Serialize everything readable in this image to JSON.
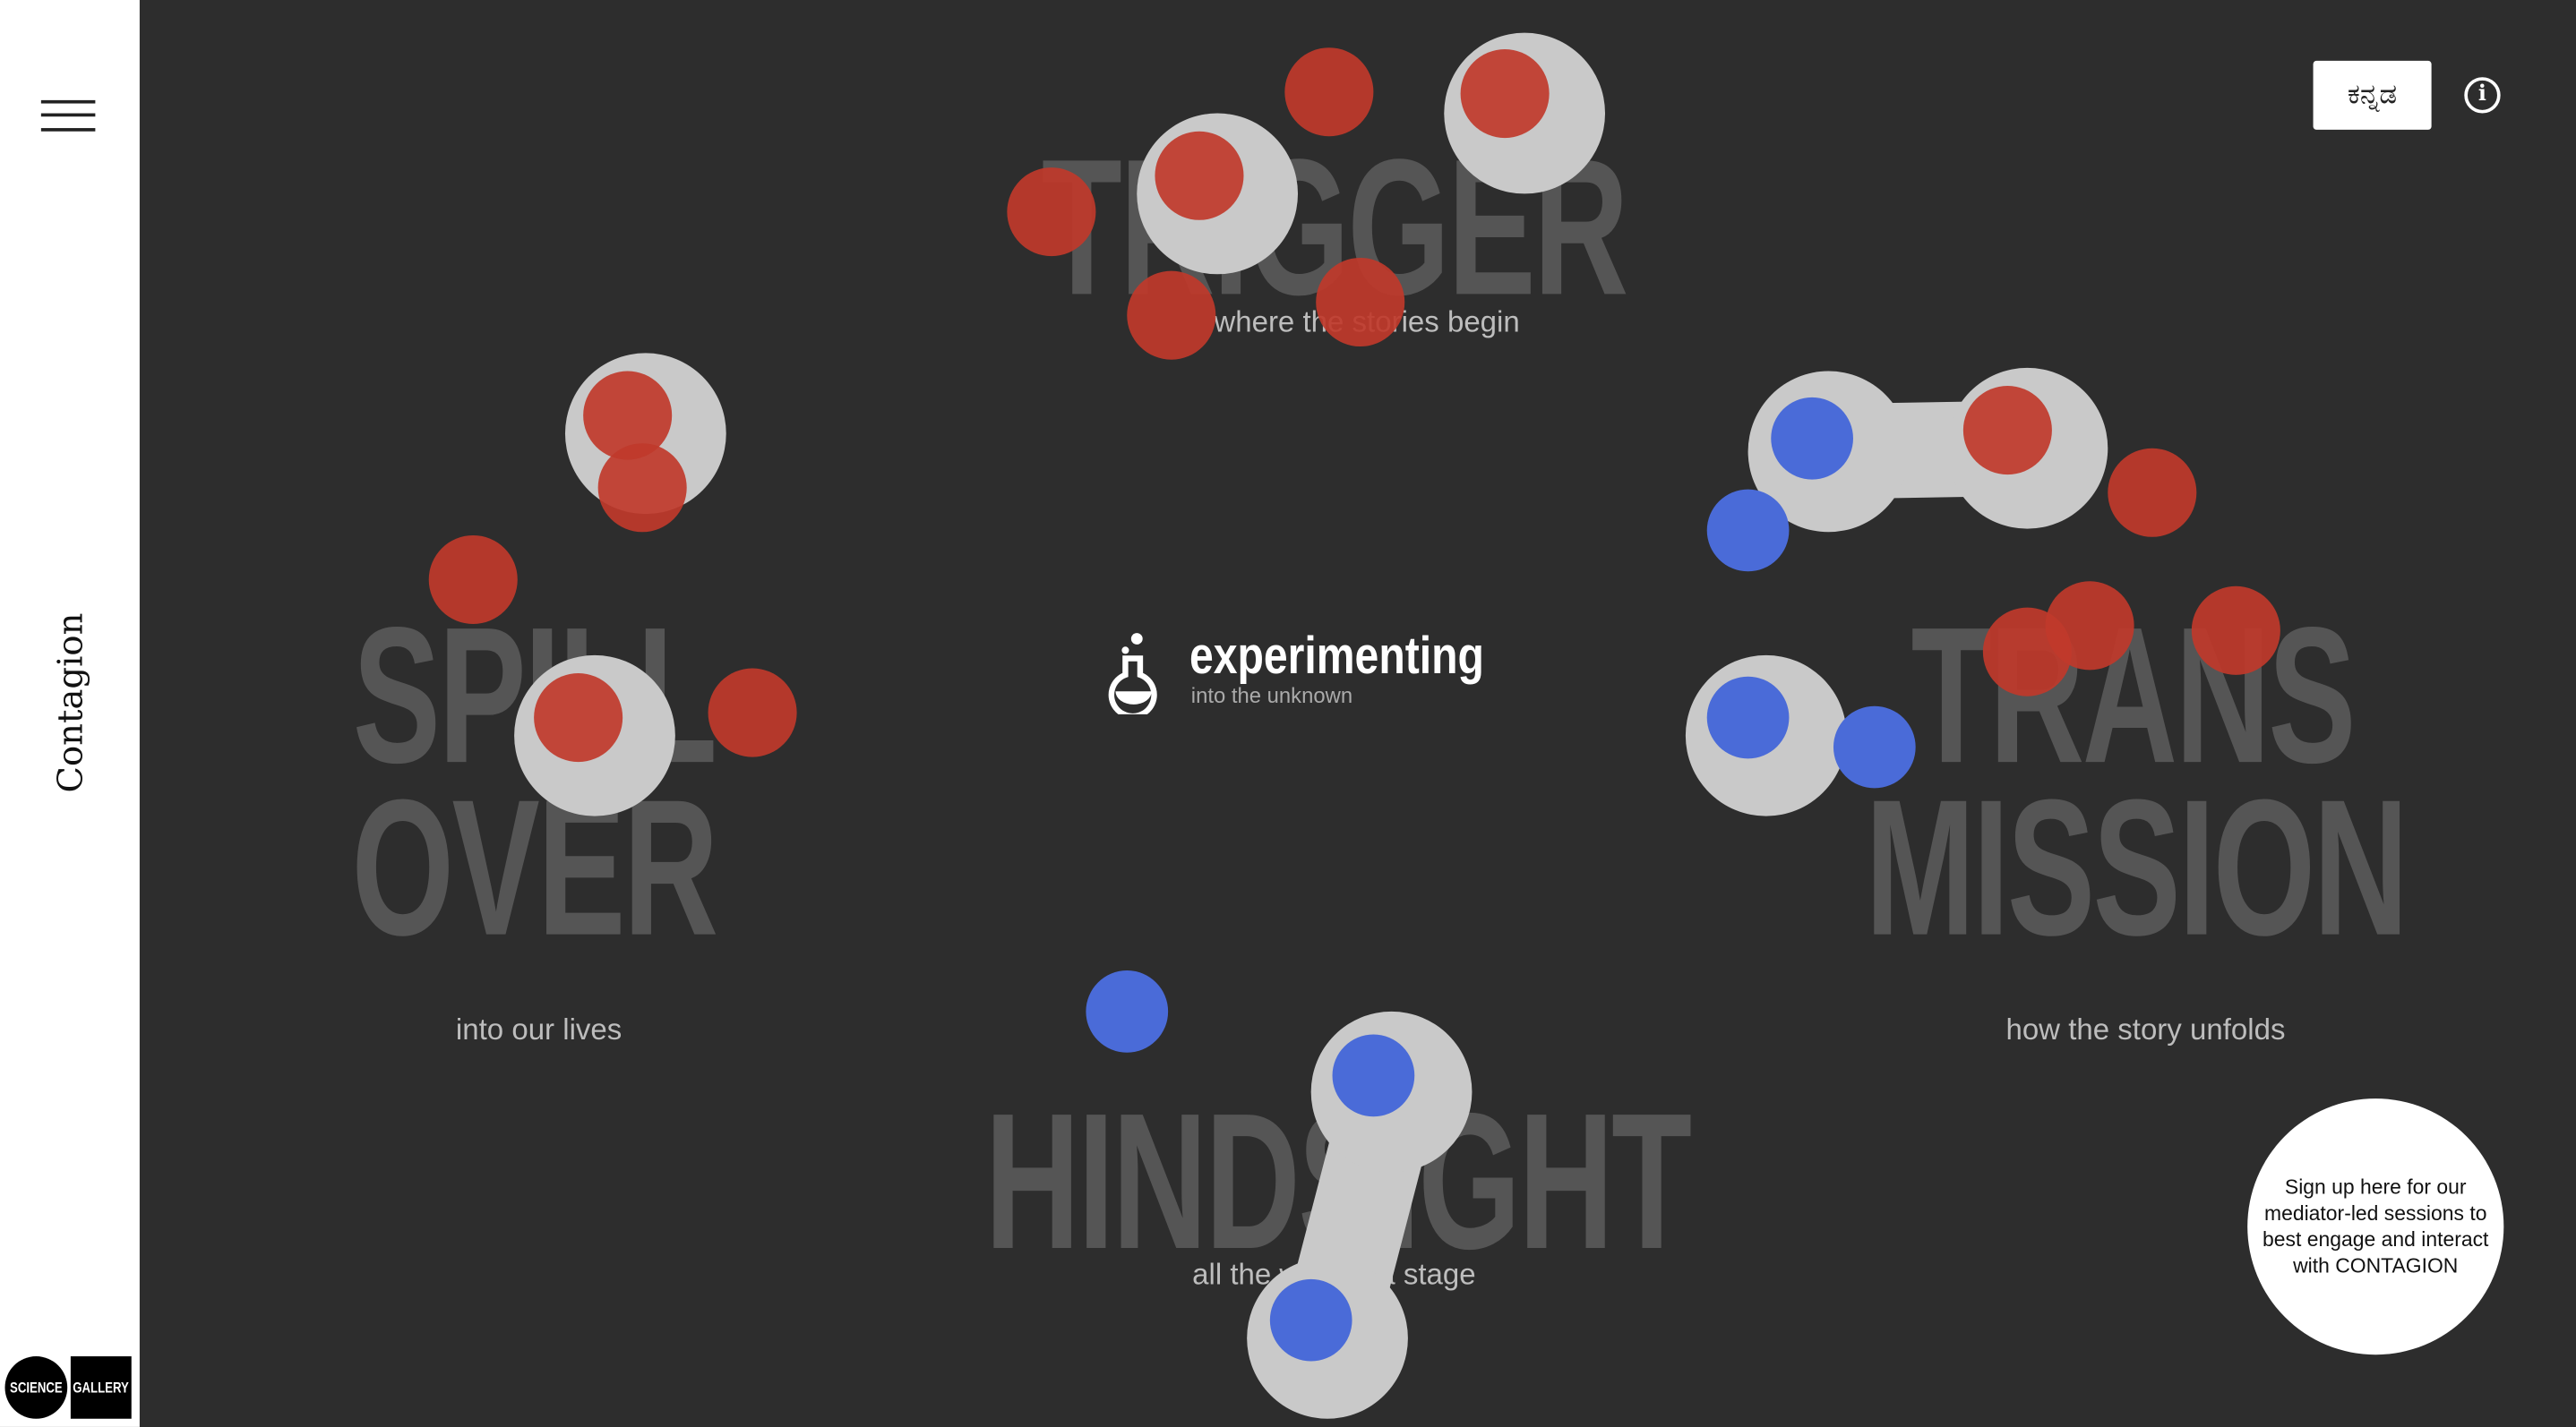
{
  "sidebar": {
    "brand": "Contagion",
    "logo": {
      "left": "SCIENCE",
      "right": "GALLERY"
    }
  },
  "header": {
    "language_button": "ಕನ್ನಡ",
    "info_icon": "info-circle-icon"
  },
  "center": {
    "title": "experimenting",
    "subtitle": "into the unknown",
    "icon": "flask-icon"
  },
  "sections": {
    "trigger": {
      "title": "TRIGGER",
      "subtitle": "where the stories begin"
    },
    "spillover": {
      "title_line1": "SPILL",
      "title_line2": "OVER",
      "subtitle": "into our lives"
    },
    "transmission": {
      "title_line1": "TRANS",
      "title_line2": "MISSION",
      "subtitle": "how the story unfolds"
    },
    "hindsight": {
      "title": "HINDSIGHT",
      "subtitle": "all the world's a stage"
    }
  },
  "signup": {
    "text": "Sign up here for our mediator-led sessions to best engage and interact with CONTAGION"
  },
  "colors": {
    "background": "#2d2d2d",
    "red": "#c0392b",
    "blue": "#4a6bd8",
    "grey": "#c9c9c9",
    "title_grey": "#555555"
  }
}
